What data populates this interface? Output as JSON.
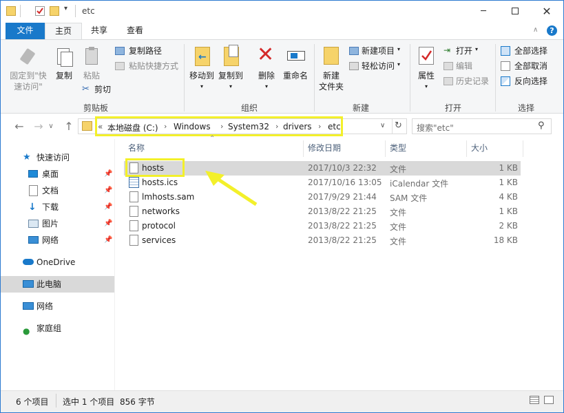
{
  "window": {
    "title": "etc",
    "minimize_icon": "minimize-icon",
    "maximize_icon": "maximize-icon",
    "close_icon": "close-icon"
  },
  "tabs": {
    "file": "文件",
    "home": "主页",
    "share": "共享",
    "view": "查看"
  },
  "ribbon": {
    "clipboard": {
      "pin": "固定到\"快\n速访问\"",
      "copy": "复制",
      "paste": "粘贴",
      "copy_path": "复制路径",
      "paste_shortcut": "粘贴快捷方式",
      "cut": "剪切",
      "group": "剪贴板"
    },
    "organize": {
      "move_to": "移动到",
      "copy_to": "复制到",
      "delete": "删除",
      "rename": "重命名",
      "group": "组织"
    },
    "new": {
      "new_folder": "新建\n文件夹",
      "new_item": "新建项目",
      "easy_access": "轻松访问",
      "group": "新建"
    },
    "open": {
      "properties": "属性",
      "open": "打开",
      "edit": "编辑",
      "history": "历史记录",
      "group": "打开"
    },
    "select": {
      "select_all": "全部选择",
      "select_none": "全部取消",
      "invert": "反向选择",
      "group": "选择"
    }
  },
  "address": {
    "overflow": "«",
    "crumbs": [
      "本地磁盘 (C:)",
      "Windows",
      "System32",
      "drivers",
      "etc"
    ],
    "search_placeholder": "搜索\"etc\""
  },
  "nav": {
    "quick_access": "快速访问",
    "desktop": "桌面",
    "documents": "文档",
    "downloads": "下载",
    "pictures": "图片",
    "network_qa": "网络",
    "onedrive": "OneDrive",
    "this_pc": "此电脑",
    "network": "网络",
    "homegroup": "家庭组"
  },
  "columns": {
    "name": "名称",
    "date": "修改日期",
    "type": "类型",
    "size": "大小"
  },
  "files": [
    {
      "name": "hosts",
      "date": "2017/10/3 22:32",
      "type": "文件",
      "size": "1 KB"
    },
    {
      "name": "hosts.ics",
      "date": "2017/10/16 13:05",
      "type": "iCalendar 文件",
      "size": "1 KB"
    },
    {
      "name": "lmhosts.sam",
      "date": "2017/9/29 21:44",
      "type": "SAM 文件",
      "size": "4 KB"
    },
    {
      "name": "networks",
      "date": "2013/8/22 21:25",
      "type": "文件",
      "size": "1 KB"
    },
    {
      "name": "protocol",
      "date": "2013/8/22 21:25",
      "type": "文件",
      "size": "2 KB"
    },
    {
      "name": "services",
      "date": "2013/8/22 21:25",
      "type": "文件",
      "size": "18 KB"
    }
  ],
  "status": {
    "count": "6 个项目",
    "selected": "选中 1 个项目",
    "size": "856 字节"
  },
  "colors": {
    "accent": "#1979ca",
    "highlight": "#f3f02a",
    "selection": "#d9d9d9"
  }
}
